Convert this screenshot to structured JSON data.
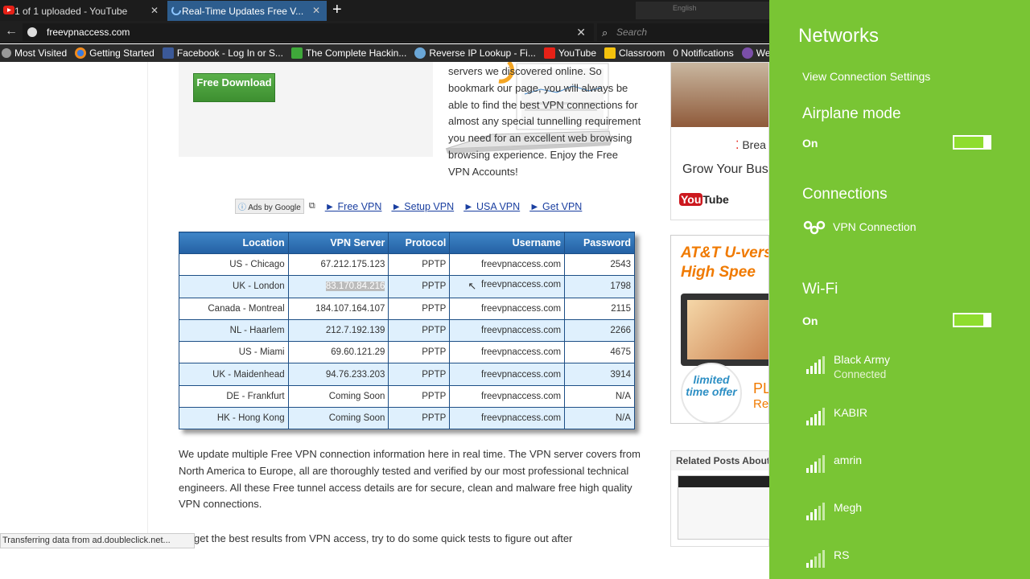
{
  "browser": {
    "tabs": [
      {
        "label": "1 of 1 uploaded - YouTube",
        "icon": "youtube-icon"
      },
      {
        "label": "Real-Time Updates Free V...",
        "icon": "loading-spinner-icon"
      }
    ],
    "new_tab_symbol": "+",
    "language": "English",
    "url": "freevpnaccess.com",
    "search_placeholder": "Search",
    "bookmarks": [
      {
        "label": "Most Visited",
        "icon": "gear-icon"
      },
      {
        "label": "Getting Started",
        "icon": "firefox-icon"
      },
      {
        "label": "Facebook - Log In or S...",
        "icon": "facebook-icon"
      },
      {
        "label": "The Complete Hackin...",
        "icon": "udemy-icon"
      },
      {
        "label": "Reverse IP Lookup - Fi...",
        "icon": "globe-icon"
      },
      {
        "label": "YouTube",
        "icon": "youtube-icon"
      },
      {
        "label": "Classroom",
        "icon": "classroom-icon"
      },
      {
        "label": "0 Notifications",
        "icon": "notification-icon"
      },
      {
        "label": "Website Pen",
        "icon": "tor-icon"
      }
    ]
  },
  "page": {
    "free_download": "Free Download",
    "intro": "servers we discovered online. So bookmark our page, you will always be able to find the best VPN connections for almost any special tunnelling requirement you need for an excellent web browsing browsing experience. Enjoy the Free VPN Accounts!",
    "ads_by_google": "Ads by Google",
    "ad_links": [
      "► Free VPN",
      "► Setup VPN",
      "► USA VPN",
      "► Get VPN"
    ],
    "table": {
      "headers": [
        "Location",
        "VPN Server",
        "Protocol",
        "Username",
        "Password"
      ],
      "rows": [
        [
          "US - Chicago",
          "67.212.175.123",
          "PPTP",
          "freevpnaccess.com",
          "2543"
        ],
        [
          "UK - London",
          "83.170.84.216",
          "PPTP",
          "freevpnaccess.com",
          "1798"
        ],
        [
          "Canada - Montreal",
          "184.107.164.107",
          "PPTP",
          "freevpnaccess.com",
          "2115"
        ],
        [
          "NL - Haarlem",
          "212.7.192.139",
          "PPTP",
          "freevpnaccess.com",
          "2266"
        ],
        [
          "US - Miami",
          "69.60.121.29",
          "PPTP",
          "freevpnaccess.com",
          "4675"
        ],
        [
          "UK - Maidenhead",
          "94.76.233.203",
          "PPTP",
          "freevpnaccess.com",
          "3914"
        ],
        [
          "DE - Frankfurt",
          "Coming Soon",
          "PPTP",
          "freevpnaccess.com",
          "N/A"
        ],
        [
          "HK - Hong Kong",
          "Coming Soon",
          "PPTP",
          "freevpnaccess.com",
          "N/A"
        ]
      ]
    },
    "para1": "We update multiple Free VPN connection information here in real time. The VPN server covers from North America to Europe, all are thoroughly tested and verified by our most professional technical engineers. All these Free tunnel access details are for secure, clean and malware free high quality VPN connections.",
    "para2": "get the best results from VPN access, try to do some quick tests to figure out after",
    "status": "Transferring data from ad.doubleclick.net...",
    "ad1": {
      "break": "Brea",
      "grow": "Grow Your Bus",
      "yt_you": "You",
      "yt_tube": "Tube"
    },
    "ad2": {
      "line1": "AT&T U-vers",
      "line2": "High Spee",
      "offer": "limited time offer",
      "pl1": "PL",
      "pl2": "Re"
    },
    "related_header": "Related Posts About F"
  },
  "taskbar": {
    "items": [
      "windows-start-icon",
      "internet-explorer-icon",
      "file-explorer-icon",
      "store-icon",
      "firefox-icon",
      "uc-browser-icon",
      "chrome-icon",
      "skype-icon",
      "remote-desktop-icon"
    ]
  },
  "networks": {
    "title": "Networks",
    "view_settings": "View Connection Settings",
    "airplane_title": "Airplane mode",
    "airplane_state": "On",
    "connections_title": "Connections",
    "vpn_label": "VPN Connection",
    "wifi_title": "Wi-Fi",
    "wifi_state": "On",
    "wifi_list": [
      {
        "name": "Black Army",
        "status": "Connected"
      },
      {
        "name": "KABIR",
        "status": ""
      },
      {
        "name": "amrin",
        "status": ""
      },
      {
        "name": "Megh",
        "status": ""
      },
      {
        "name": "RS",
        "status": ""
      }
    ],
    "accent": "#79c534"
  }
}
